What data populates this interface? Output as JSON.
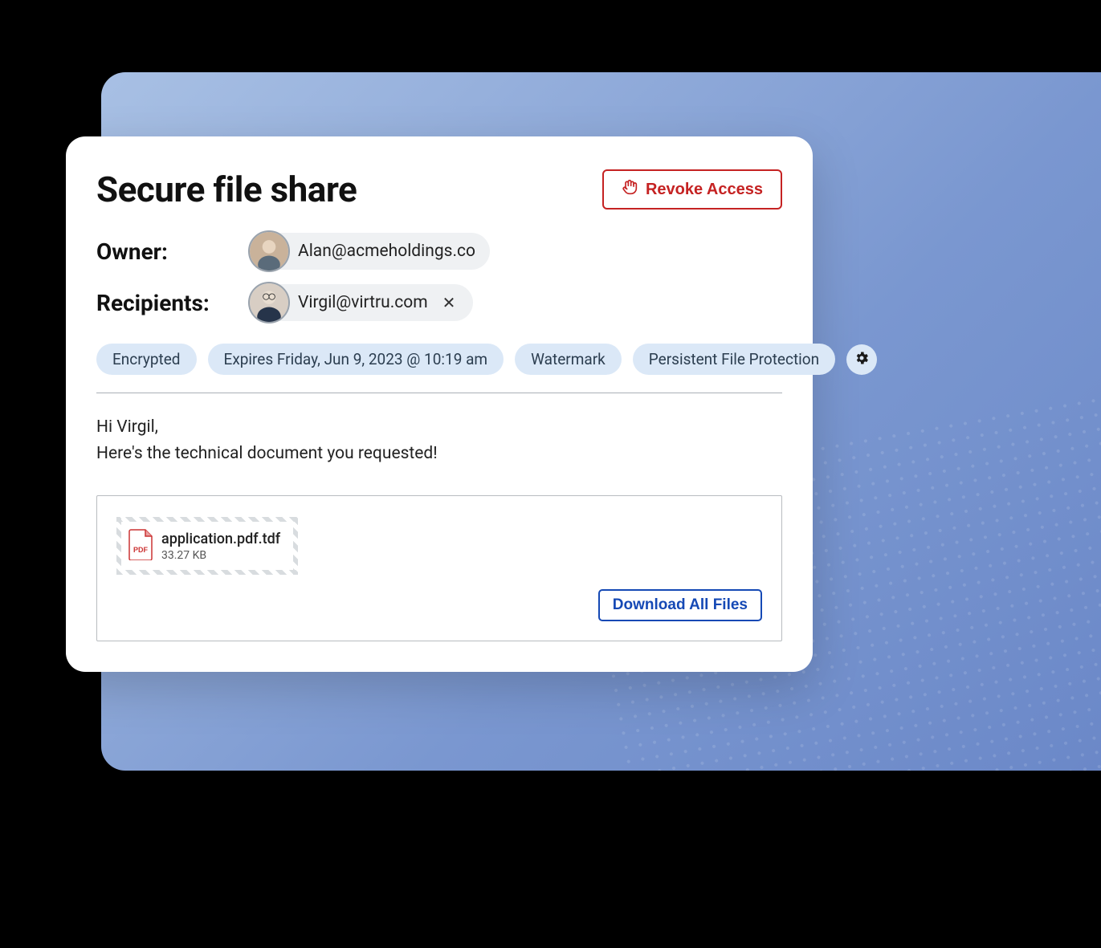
{
  "card": {
    "title": "Secure file share",
    "revoke_label": "Revoke Access"
  },
  "owner": {
    "label": "Owner:",
    "email": "Alan@acmeholdings.co"
  },
  "recipients": {
    "label": "Recipients:",
    "items": [
      {
        "email": "Virgil@virtru.com"
      }
    ]
  },
  "tags": {
    "encrypted": "Encrypted",
    "expires": "Expires Friday, Jun 9, 2023 @ 10:19 am",
    "watermark": "Watermark",
    "persistent": "Persistent File Protection"
  },
  "message": {
    "line1": "Hi Virgil,",
    "line2": "Here's the technical document you requested!"
  },
  "files": {
    "items": [
      {
        "name": "application.pdf.tdf",
        "size": "33.27 KB"
      }
    ],
    "download_all_label": "Download All Files"
  }
}
